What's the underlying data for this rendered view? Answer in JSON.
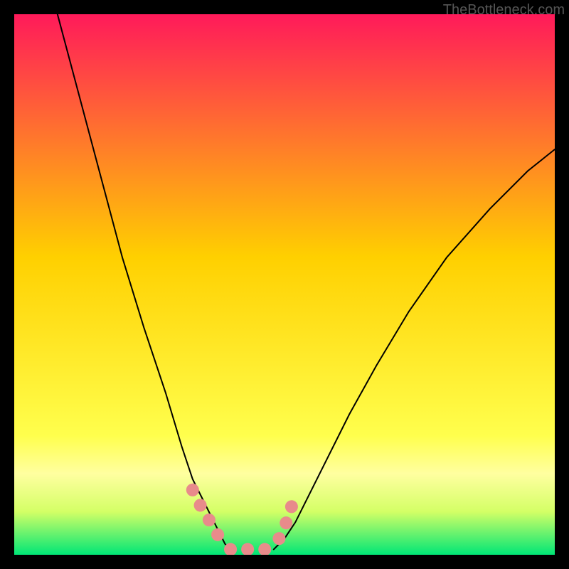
{
  "watermark": "TheBottleneck.com",
  "chart_data": {
    "type": "line",
    "title": "",
    "xlabel": "",
    "ylabel": "",
    "xlim": [
      0,
      100
    ],
    "ylim": [
      0,
      100
    ],
    "background": {
      "type": "vertical-gradient",
      "stops": [
        {
          "offset": 0,
          "color": "#ff1a5a"
        },
        {
          "offset": 0.45,
          "color": "#ffd000"
        },
        {
          "offset": 0.78,
          "color": "#ffff4d"
        },
        {
          "offset": 0.85,
          "color": "#ffffa0"
        },
        {
          "offset": 0.92,
          "color": "#d4ff66"
        },
        {
          "offset": 1.0,
          "color": "#00e676"
        }
      ]
    },
    "series": [
      {
        "name": "left-curve",
        "stroke": "#000000",
        "x": [
          8,
          12,
          16,
          20,
          24,
          28,
          31,
          33,
          35,
          37,
          38,
          39,
          40
        ],
        "y": [
          100,
          85,
          70,
          55,
          42,
          30,
          20,
          14,
          10,
          6,
          4,
          2,
          1
        ]
      },
      {
        "name": "right-curve",
        "stroke": "#000000",
        "x": [
          48,
          50,
          52,
          55,
          58,
          62,
          67,
          73,
          80,
          88,
          95,
          100
        ],
        "y": [
          1,
          3,
          6,
          12,
          18,
          26,
          35,
          45,
          55,
          64,
          71,
          75
        ]
      },
      {
        "name": "bottom-markers-left",
        "stroke": "#e88b8b",
        "marker": "round",
        "x": [
          33,
          35,
          37,
          38,
          39
        ],
        "y": [
          12,
          8,
          5,
          3,
          2
        ]
      },
      {
        "name": "bottom-markers-flat",
        "stroke": "#e88b8b",
        "marker": "round",
        "x": [
          40,
          42,
          44,
          46,
          48
        ],
        "y": [
          1,
          1,
          1,
          1,
          1
        ]
      },
      {
        "name": "bottom-markers-right",
        "stroke": "#e88b8b",
        "marker": "round",
        "x": [
          49,
          50,
          51,
          52
        ],
        "y": [
          3,
          5,
          8,
          11
        ]
      }
    ]
  }
}
